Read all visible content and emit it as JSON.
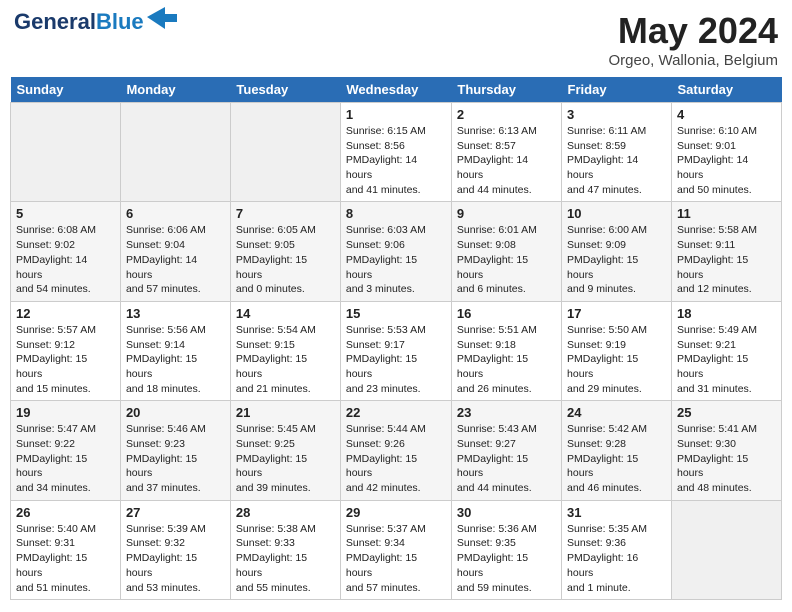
{
  "logo": {
    "line1": "General",
    "line2": "Blue"
  },
  "title": "May 2024",
  "location": "Orgeo, Wallonia, Belgium",
  "days_header": [
    "Sunday",
    "Monday",
    "Tuesday",
    "Wednesday",
    "Thursday",
    "Friday",
    "Saturday"
  ],
  "weeks": [
    [
      {
        "day": "",
        "content": ""
      },
      {
        "day": "",
        "content": ""
      },
      {
        "day": "",
        "content": ""
      },
      {
        "day": "1",
        "content": "Sunrise: 6:15 AM\nSunset: 8:56 PM\nDaylight: 14 hours\nand 41 minutes."
      },
      {
        "day": "2",
        "content": "Sunrise: 6:13 AM\nSunset: 8:57 PM\nDaylight: 14 hours\nand 44 minutes."
      },
      {
        "day": "3",
        "content": "Sunrise: 6:11 AM\nSunset: 8:59 PM\nDaylight: 14 hours\nand 47 minutes."
      },
      {
        "day": "4",
        "content": "Sunrise: 6:10 AM\nSunset: 9:01 PM\nDaylight: 14 hours\nand 50 minutes."
      }
    ],
    [
      {
        "day": "5",
        "content": "Sunrise: 6:08 AM\nSunset: 9:02 PM\nDaylight: 14 hours\nand 54 minutes."
      },
      {
        "day": "6",
        "content": "Sunrise: 6:06 AM\nSunset: 9:04 PM\nDaylight: 14 hours\nand 57 minutes."
      },
      {
        "day": "7",
        "content": "Sunrise: 6:05 AM\nSunset: 9:05 PM\nDaylight: 15 hours\nand 0 minutes."
      },
      {
        "day": "8",
        "content": "Sunrise: 6:03 AM\nSunset: 9:06 PM\nDaylight: 15 hours\nand 3 minutes."
      },
      {
        "day": "9",
        "content": "Sunrise: 6:01 AM\nSunset: 9:08 PM\nDaylight: 15 hours\nand 6 minutes."
      },
      {
        "day": "10",
        "content": "Sunrise: 6:00 AM\nSunset: 9:09 PM\nDaylight: 15 hours\nand 9 minutes."
      },
      {
        "day": "11",
        "content": "Sunrise: 5:58 AM\nSunset: 9:11 PM\nDaylight: 15 hours\nand 12 minutes."
      }
    ],
    [
      {
        "day": "12",
        "content": "Sunrise: 5:57 AM\nSunset: 9:12 PM\nDaylight: 15 hours\nand 15 minutes."
      },
      {
        "day": "13",
        "content": "Sunrise: 5:56 AM\nSunset: 9:14 PM\nDaylight: 15 hours\nand 18 minutes."
      },
      {
        "day": "14",
        "content": "Sunrise: 5:54 AM\nSunset: 9:15 PM\nDaylight: 15 hours\nand 21 minutes."
      },
      {
        "day": "15",
        "content": "Sunrise: 5:53 AM\nSunset: 9:17 PM\nDaylight: 15 hours\nand 23 minutes."
      },
      {
        "day": "16",
        "content": "Sunrise: 5:51 AM\nSunset: 9:18 PM\nDaylight: 15 hours\nand 26 minutes."
      },
      {
        "day": "17",
        "content": "Sunrise: 5:50 AM\nSunset: 9:19 PM\nDaylight: 15 hours\nand 29 minutes."
      },
      {
        "day": "18",
        "content": "Sunrise: 5:49 AM\nSunset: 9:21 PM\nDaylight: 15 hours\nand 31 minutes."
      }
    ],
    [
      {
        "day": "19",
        "content": "Sunrise: 5:47 AM\nSunset: 9:22 PM\nDaylight: 15 hours\nand 34 minutes."
      },
      {
        "day": "20",
        "content": "Sunrise: 5:46 AM\nSunset: 9:23 PM\nDaylight: 15 hours\nand 37 minutes."
      },
      {
        "day": "21",
        "content": "Sunrise: 5:45 AM\nSunset: 9:25 PM\nDaylight: 15 hours\nand 39 minutes."
      },
      {
        "day": "22",
        "content": "Sunrise: 5:44 AM\nSunset: 9:26 PM\nDaylight: 15 hours\nand 42 minutes."
      },
      {
        "day": "23",
        "content": "Sunrise: 5:43 AM\nSunset: 9:27 PM\nDaylight: 15 hours\nand 44 minutes."
      },
      {
        "day": "24",
        "content": "Sunrise: 5:42 AM\nSunset: 9:28 PM\nDaylight: 15 hours\nand 46 minutes."
      },
      {
        "day": "25",
        "content": "Sunrise: 5:41 AM\nSunset: 9:30 PM\nDaylight: 15 hours\nand 48 minutes."
      }
    ],
    [
      {
        "day": "26",
        "content": "Sunrise: 5:40 AM\nSunset: 9:31 PM\nDaylight: 15 hours\nand 51 minutes."
      },
      {
        "day": "27",
        "content": "Sunrise: 5:39 AM\nSunset: 9:32 PM\nDaylight: 15 hours\nand 53 minutes."
      },
      {
        "day": "28",
        "content": "Sunrise: 5:38 AM\nSunset: 9:33 PM\nDaylight: 15 hours\nand 55 minutes."
      },
      {
        "day": "29",
        "content": "Sunrise: 5:37 AM\nSunset: 9:34 PM\nDaylight: 15 hours\nand 57 minutes."
      },
      {
        "day": "30",
        "content": "Sunrise: 5:36 AM\nSunset: 9:35 PM\nDaylight: 15 hours\nand 59 minutes."
      },
      {
        "day": "31",
        "content": "Sunrise: 5:35 AM\nSunset: 9:36 PM\nDaylight: 16 hours\nand 1 minute."
      },
      {
        "day": "",
        "content": ""
      }
    ]
  ]
}
